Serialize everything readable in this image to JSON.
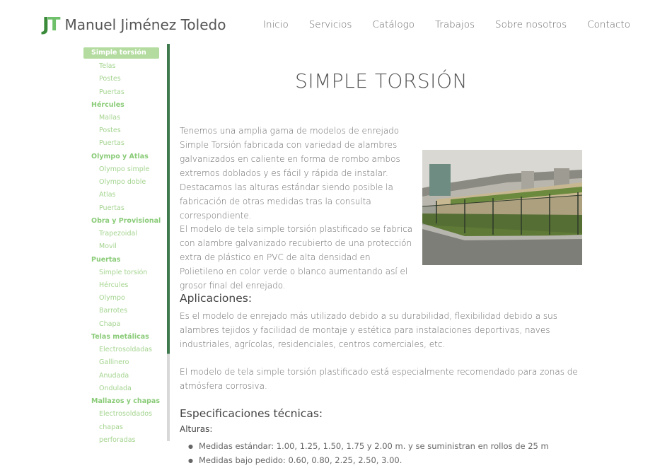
{
  "header": {
    "logo_mark_j": "J",
    "logo_mark_t": "T",
    "brand_name": "Manuel Jiménez Toledo",
    "nav": [
      "Inicio",
      "Servicios",
      "Catálogo",
      "Trabajos",
      "Sobre nosotros",
      "Contacto"
    ]
  },
  "sidebar": {
    "groups": [
      {
        "label": "Simple torsión",
        "active": true,
        "items": [
          "Telas",
          "Postes",
          "Puertas"
        ]
      },
      {
        "label": "Hércules",
        "items": [
          "Mallas",
          "Postes",
          "Puertas"
        ]
      },
      {
        "label": "Olympo y Atlas",
        "items": [
          "Olympo simple",
          "Olympo doble",
          "Atlas",
          "Puertas"
        ]
      },
      {
        "label": "Obra y Provisional",
        "items": [
          "Trapezoidal",
          "Movil"
        ]
      },
      {
        "label": "Puertas",
        "items": [
          "Simple torsión",
          "Hércules",
          "Olympo",
          "Barrotes",
          "Chapa"
        ]
      },
      {
        "label": "Telas metálicas",
        "items": [
          "Electrosoldadas",
          "Gallinero",
          "Anudada",
          "Ondulada"
        ]
      },
      {
        "label": "Mallazos y chapas",
        "items": [
          "Electrosoldados",
          "chapas",
          "perforadas"
        ]
      }
    ]
  },
  "main": {
    "title": "SIMPLE TORSIÓN",
    "intro": "Tenemos una amplia gama de modelos de enrejado Simple Torsión fabricada con variedad de alambres galvanizados en caliente en forma de rombo ambos extremos doblados y es fácil y rápida de instalar. Destacamos las alturas estándar siendo posible la fabricación de otras medidas tras la consulta correspondiente.",
    "plastificado": "El modelo de tela simple torsión plastificado se fabrica con alambre galvanizado recubierto de una protección extra de plástico en PVC de alta densidad en Polietileno en color verde o blanco aumentando así el grosor final del enrejado.",
    "aplicaciones_heading": "Aplicaciones:",
    "aplicaciones_text": "Es el modelo de enrejado más utilizado debido a su durabilidad, flexibilidad debido a sus alambres tejidos y facilidad de montaje y estética para instalaciones deportivas, naves industriales, agrícolas, residenciales, centros comerciales, etc.",
    "recomendado_text": "El modelo de tela simple torsión plastificado está especialmente recomendado para zonas de atmósfera corrosiva.",
    "especificaciones_heading": "Especificaciones técnicas:",
    "alturas_label": "Alturas:",
    "alturas_list": [
      "Medidas estándar: 1.00, 1.25, 1.50, 1.75 y 2.00 m. y se suministran en rollos de 25 m",
      "Medidas bajo pedido: 0.60, 0.80, 2.25, 2.50, 3.00."
    ]
  },
  "colors": {
    "accent": "#3e7a4e",
    "sidebar_text": "#a4d48f",
    "active_bg": "#b4dca0"
  }
}
